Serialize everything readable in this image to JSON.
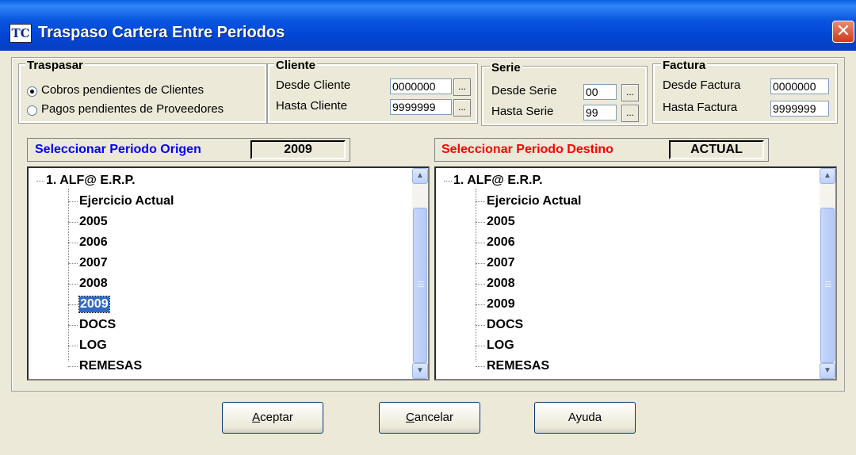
{
  "window": {
    "icon_text": "TC",
    "title": "Traspaso Cartera Entre Periodos",
    "close_label": "✕"
  },
  "traspasar": {
    "legend": "Traspasar",
    "options": [
      {
        "label": "Cobros pendientes de Clientes",
        "checked": true
      },
      {
        "label": "Pagos pendientes de Proveedores",
        "checked": false
      }
    ]
  },
  "cliente": {
    "legend": "Cliente",
    "desde_label": "Desde Cliente",
    "desde_value": "0000000",
    "hasta_label": "Hasta Cliente",
    "hasta_value": "9999999",
    "browse_label": "..."
  },
  "serie": {
    "legend": "Serie",
    "desde_label": "Desde Serie",
    "desde_value": "00",
    "hasta_label": "Hasta Serie",
    "hasta_value": "99",
    "browse_label": "..."
  },
  "factura": {
    "legend": "Factura",
    "desde_label": "Desde Factura",
    "desde_value": "0000000",
    "hasta_label": "Hasta Factura",
    "hasta_value": "9999999"
  },
  "origen": {
    "label": "Seleccionar Periodo Origen",
    "label_color": "#0000ff",
    "value": "2009",
    "tree": {
      "root": "1. ALF@ E.R.P.",
      "children": [
        "Ejercicio Actual",
        "2005",
        "2006",
        "2007",
        "2008",
        "2009",
        "DOCS",
        "LOG",
        "REMESAS"
      ],
      "selected": "2009"
    }
  },
  "destino": {
    "label": "Seleccionar Periodo Destino",
    "label_color": "#ff0000",
    "value": "ACTUAL",
    "tree": {
      "root": "1. ALF@ E.R.P.",
      "children": [
        "Ejercicio Actual",
        "2005",
        "2006",
        "2007",
        "2008",
        "2009",
        "DOCS",
        "LOG",
        "REMESAS"
      ]
    }
  },
  "buttons": {
    "accept": {
      "mnemonic": "A",
      "rest": "ceptar"
    },
    "cancel": {
      "mnemonic": "C",
      "rest": "ancelar"
    },
    "help": "Ayuda"
  }
}
